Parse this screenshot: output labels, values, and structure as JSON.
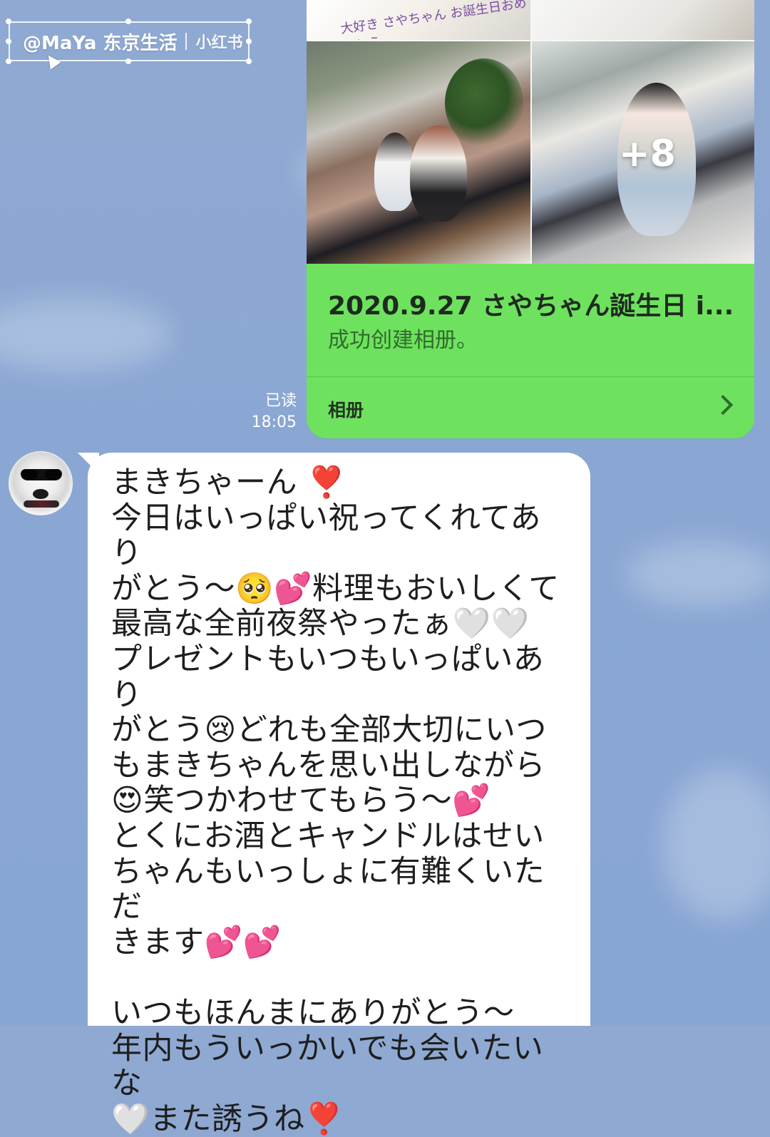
{
  "watermark": {
    "text": "@MaYa 东京生活",
    "brand": "小红书"
  },
  "album": {
    "title": "2020.9.27 さやちゃん誕生日 i...",
    "subtitle": "成功创建相册。",
    "footer_label": "相册",
    "more_count": "+8",
    "photo_texts": {
      "plate_top": "大好き  さやちゃん  お誕生日おめでとう"
    }
  },
  "meta": {
    "read_status": "已读",
    "time": "18:05"
  },
  "message": {
    "text": "まきちゃーん ❣️\n今日はいっぱい祝ってくれてあり\nがとう〜🥺💕料理もおいしくて\n最高な全前夜祭やったぁ🤍🤍\nプレゼントもいつもいっぱいあり\nがとう😢どれも全部大切にいつ\nもまきちゃんを思い出しながら\n😍笑つかわせてもらう〜💕\nとくにお酒とキャンドルはせい\nちゃんもいっしょに有難くいただ\nきます💕💕\n\nいつもほんまにありがとう〜\n年内もういっかいでも会いたいな\n🤍また誘うね❣️"
  },
  "colors": {
    "background": "#8aa7d3",
    "album_green": "#6ee25e",
    "bubble_white": "#ffffff",
    "text_dark": "#1e1e1e"
  },
  "icons": {
    "chevron": "chevron-right-icon",
    "cursor": "cursor-icon"
  }
}
